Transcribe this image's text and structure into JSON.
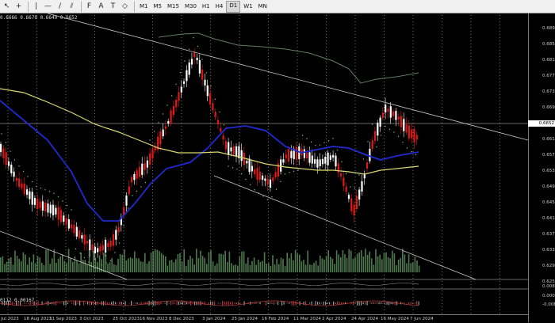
{
  "toolbar": {
    "tools": [
      "cursor-icon",
      "crosshair-icon",
      "vertical-line-icon",
      "horizontal-line-icon",
      "trendline-icon",
      "channel-icon",
      "fibonacci-icon",
      "text-icon",
      "label-icon",
      "shapes-icon"
    ],
    "text_tool": "A",
    "timeframes": [
      "M1",
      "M5",
      "M15",
      "M30",
      "H1",
      "H4",
      "D1",
      "W1",
      "MN"
    ],
    "active_timeframe": "D1"
  },
  "chart": {
    "ohlc_readout": "0.6666 0.6670 0.6649 0.6652",
    "indicator_readout": "0112 0.00167",
    "current_price": "0.6652",
    "price_levels": [
      "0.6895",
      "0.6855",
      "0.6815",
      "0.6775",
      "0.6735",
      "0.6695",
      "0.6655",
      "0.6615",
      "0.6575",
      "0.6535",
      "0.6495",
      "0.6455",
      "0.6415",
      "0.6375",
      "0.6335",
      "0.6295",
      "0.6255"
    ],
    "indicator_levels": [
      "0.00893",
      "0.00000",
      "-0.00650"
    ],
    "time_labels": [
      "1 Jul 2023",
      "18 Aug 2023",
      "11 Sep 2023",
      "3 Oct 2023",
      "25 Oct 2023",
      "16 Nov 2023",
      "8 Dec 2023",
      "3 Jan 2024",
      "25 Jan 2024",
      "16 Feb 2024",
      "11 Mar 2024",
      "2 Apr 2024",
      "24 Apr 2024",
      "16 May 2024",
      "7 Jun 2024"
    ],
    "colors": {
      "bull": "#ffffff",
      "bear": "#e01818",
      "ma_blue": "#1f2bd0",
      "ma_yellow": "#d8d870",
      "ma_grey": "#5f7f5f",
      "volume": "#4f7a4f",
      "trend": "#c8c8c8",
      "psar": "#90c060",
      "grid": "#bbbbbb"
    }
  }
}
